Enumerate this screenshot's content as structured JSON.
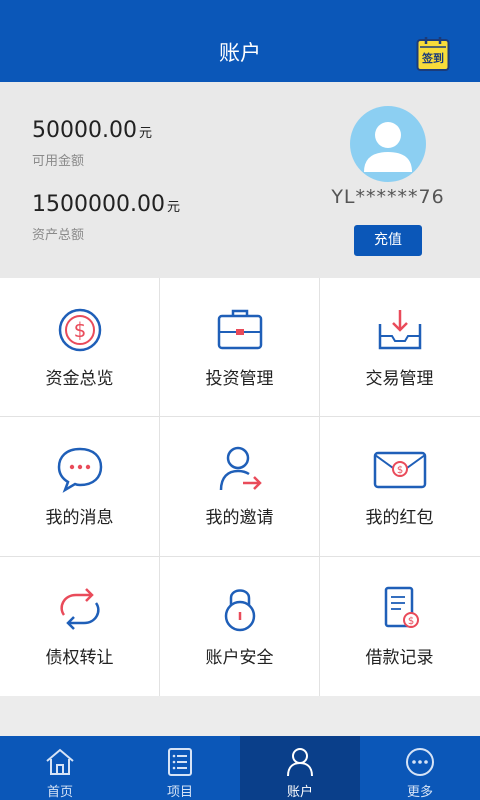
{
  "header": {
    "title": "账户",
    "signin_label": "签到"
  },
  "summary": {
    "available_amount": "50000.00",
    "available_unit": "元",
    "available_label": "可用金额",
    "total_amount": "1500000.00",
    "total_unit": "元",
    "total_label": "资产总额",
    "username": "YL******76",
    "recharge_label": "充值"
  },
  "grid": {
    "items": [
      {
        "label": "资金总览",
        "icon": "dollar-coin-icon"
      },
      {
        "label": "投资管理",
        "icon": "briefcase-icon"
      },
      {
        "label": "交易管理",
        "icon": "tray-download-icon"
      },
      {
        "label": "我的消息",
        "icon": "chat-bubble-icon"
      },
      {
        "label": "我的邀请",
        "icon": "user-arrow-icon"
      },
      {
        "label": "我的红包",
        "icon": "red-envelope-icon"
      },
      {
        "label": "债权转让",
        "icon": "transfer-cycle-icon"
      },
      {
        "label": "账户安全",
        "icon": "padlock-icon"
      },
      {
        "label": "借款记录",
        "icon": "document-record-icon"
      }
    ]
  },
  "tabbar": {
    "tabs": [
      {
        "label": "首页",
        "icon": "home-icon",
        "active": false
      },
      {
        "label": "项目",
        "icon": "list-icon",
        "active": false
      },
      {
        "label": "账户",
        "icon": "user-icon",
        "active": true
      },
      {
        "label": "更多",
        "icon": "more-icon",
        "active": false
      }
    ]
  },
  "colors": {
    "primary": "#0b57b8",
    "active_tab": "#0a3f8a",
    "accent_red": "#e94b5a",
    "avatar_bg": "#8ccff2"
  }
}
